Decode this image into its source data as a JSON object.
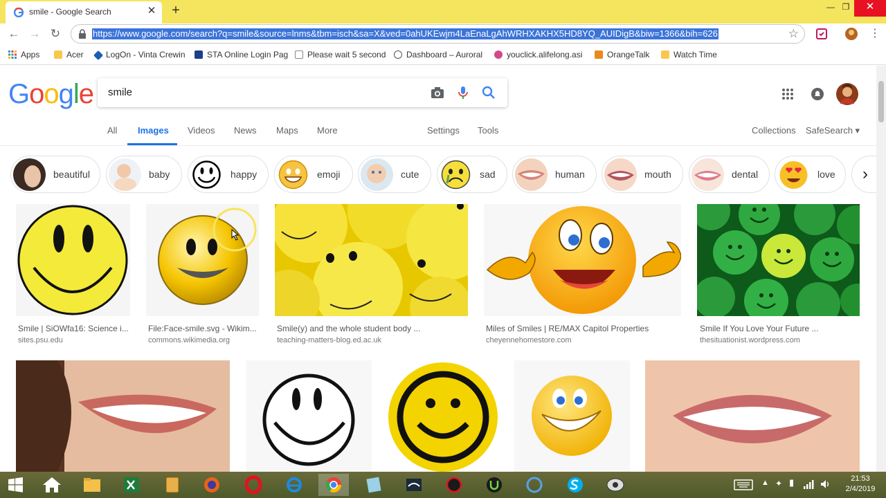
{
  "window": {
    "tab_title": "smile - Google Search",
    "close_tab_glyph": "✕",
    "new_tab_glyph": "+",
    "minimize_glyph": "—",
    "maximize_glyph": "❐",
    "close_glyph": "✕"
  },
  "toolbar": {
    "url": "https://www.google.com/search?q=smile&source=lnms&tbm=isch&sa=X&ved=0ahUKEwjm4LaEnaLgAhWRHXAKHX5HD8YQ_AUIDigB&biw=1366&bih=626",
    "back_glyph": "←",
    "forward_glyph": "→",
    "reload_glyph": "↻",
    "star_glyph": "☆"
  },
  "bookmarks": [
    {
      "label": "Apps",
      "color": "#4285f4"
    },
    {
      "label": "Acer",
      "color": "#f9c74f"
    },
    {
      "label": "LogOn - Vinta Crewin",
      "color": "#1a5fb4"
    },
    {
      "label": "STA Online Login Pag",
      "color": "#1c3f8c"
    },
    {
      "label": "Please wait 5 second",
      "color": "#888888"
    },
    {
      "label": "Dashboard – Auroral",
      "color": "#555555"
    },
    {
      "label": "youclick.alifelong.asi",
      "color": "#d4488a"
    },
    {
      "label": "OrangeTalk",
      "color": "#e88a1a"
    },
    {
      "label": "Watch Time",
      "color": "#f9c74f"
    }
  ],
  "google": {
    "logo_letters": [
      "G",
      "o",
      "o",
      "g",
      "l",
      "e"
    ],
    "logo_colors": [
      "#4285f4",
      "#ea4335",
      "#fbbc05",
      "#4285f4",
      "#34a853",
      "#ea4335"
    ],
    "query": "smile"
  },
  "nav": {
    "all": "All",
    "images": "Images",
    "videos": "Videos",
    "news": "News",
    "maps": "Maps",
    "more": "More",
    "settings": "Settings",
    "tools": "Tools",
    "collections": "Collections",
    "safesearch": "SafeSearch ▾"
  },
  "chips": [
    {
      "label": "beautiful"
    },
    {
      "label": "baby"
    },
    {
      "label": "happy"
    },
    {
      "label": "emoji"
    },
    {
      "label": "cute"
    },
    {
      "label": "sad"
    },
    {
      "label": "human"
    },
    {
      "label": "mouth"
    },
    {
      "label": "dental"
    },
    {
      "label": "love"
    }
  ],
  "chip_next_glyph": "›",
  "results_row1": [
    {
      "title": "Smile | SiOWfa16: Science i...",
      "source": "sites.psu.edu"
    },
    {
      "title": "File:Face-smile.svg - Wikim...",
      "source": "commons.wikimedia.org"
    },
    {
      "title": "Smile(y) and the whole student body ...",
      "source": "teaching-matters-blog.ed.ac.uk"
    },
    {
      "title": "Miles of Smiles | RE/MAX Capitol Properties",
      "source": "cheyennehomestore.com"
    },
    {
      "title": "Smile If You Love Your Future ...",
      "source": "thesituationist.wordpress.com"
    }
  ],
  "taskbar": {
    "clock_time": "21:53",
    "clock_date": "2/4/2019",
    "apps": [
      "start",
      "home",
      "file-explorer",
      "excel",
      "notes",
      "firefox",
      "opera",
      "internet-explorer",
      "chrome",
      "paint",
      "media",
      "game",
      "upwork",
      "browser",
      "skype",
      "camera"
    ]
  }
}
